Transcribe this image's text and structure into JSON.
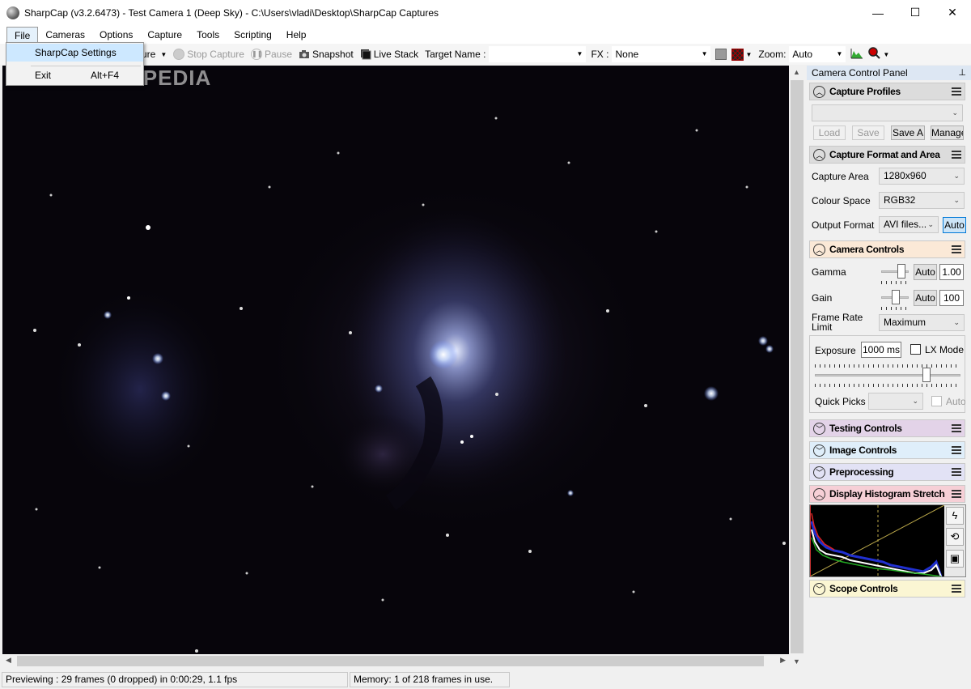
{
  "window": {
    "title": "SharpCap (v3.2.6473) - Test Camera 1 (Deep Sky) - C:\\Users\\vladi\\Desktop\\SharpCap Captures",
    "minimize": "—",
    "maximize": "☐",
    "close": "✕"
  },
  "menu": {
    "items": [
      "File",
      "Cameras",
      "Options",
      "Capture",
      "Tools",
      "Scripting",
      "Help"
    ]
  },
  "file_menu": {
    "settings": "SharpCap Settings",
    "exit": "Exit",
    "exit_shortcut": "Alt+F4"
  },
  "toolbar": {
    "capture_partial": "ure",
    "stop_capture": "Stop Capture",
    "pause": "Pause",
    "snapshot": "Snapshot",
    "live_stack": "Live Stack",
    "target_name_label": "Target Name :",
    "target_name_value": "",
    "fx_label": "FX :",
    "fx_value": "None",
    "zoom_label": "Zoom:",
    "zoom_value": "Auto"
  },
  "watermark": "FTPEDIA",
  "status": {
    "preview": "Previewing : 29 frames (0 dropped) in 0:00:29, 1.1 fps",
    "memory": "Memory: 1 of 218 frames in use."
  },
  "panel": {
    "title": "Camera Control Panel",
    "pin": "📌",
    "capture_profiles": {
      "title": "Capture Profiles",
      "profile_value": "",
      "load": "Load",
      "save": "Save",
      "save_as": "Save A",
      "manage": "Manage"
    },
    "capture_format": {
      "title": "Capture Format and Area",
      "capture_area_label": "Capture Area",
      "capture_area_value": "1280x960",
      "colour_space_label": "Colour Space",
      "colour_space_value": "RGB32",
      "output_format_label": "Output Format",
      "output_format_value": "AVI files...",
      "output_auto": "Auto"
    },
    "camera_controls": {
      "title": "Camera Controls",
      "gamma_label": "Gamma",
      "gamma_auto": "Auto",
      "gamma_value": "1.00",
      "gamma_level": 0.85,
      "gain_label": "Gain",
      "gain_auto": "Auto",
      "gain_value": "100",
      "gain_level": 0.55,
      "frame_rate_label_1": "Frame Rate",
      "frame_rate_label_2": "Limit",
      "frame_rate_value": "Maximum",
      "exposure_label": "Exposure",
      "exposure_value": "1000 ms",
      "lx_mode": "LX Mode",
      "exposure_level": 0.78,
      "quick_picks_label": "Quick Picks",
      "quick_picks_value": "",
      "quick_auto": "Auto"
    },
    "testing_controls": {
      "title": "Testing Controls"
    },
    "image_controls": {
      "title": "Image Controls"
    },
    "preprocessing": {
      "title": "Preprocessing"
    },
    "histogram_stretch": {
      "title": "Display Histogram Stretch"
    },
    "scope_controls": {
      "title": "Scope Controls"
    }
  },
  "colors": {
    "camera_controls_header": "#fbe9d7",
    "testing_controls_header": "#e3d3e8",
    "image_controls_header": "#dfeefa",
    "preprocessing_header": "#e2e2f5",
    "histogram_header": "#f6cfd6",
    "scope_controls_header": "#fbf6d3",
    "capture_header": "#dcdcdc"
  }
}
